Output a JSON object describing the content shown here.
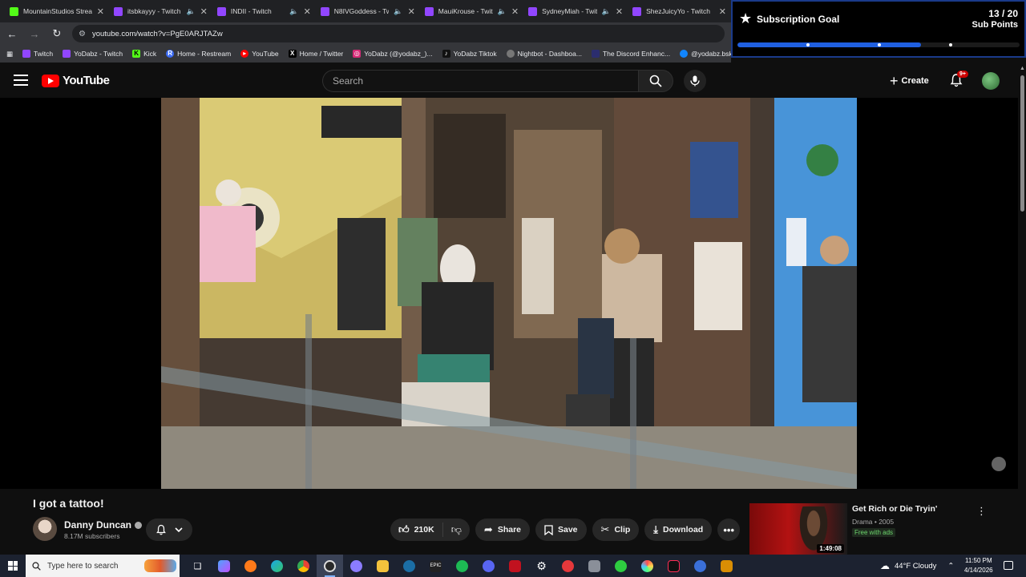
{
  "browser": {
    "tabs": [
      {
        "title": "MountainStudios Strea",
        "favicon": "kick-icon",
        "muted": false
      },
      {
        "title": "itsbkayyy - Twitch",
        "favicon": "twitch-icon",
        "muted": true
      },
      {
        "title": "INDII - Twitch",
        "favicon": "twitch-icon",
        "muted": true
      },
      {
        "title": "N8IVGoddess - Twi",
        "favicon": "twitch-icon",
        "muted": true
      },
      {
        "title": "MauiKrouse - Twit",
        "favicon": "twitch-icon",
        "muted": true
      },
      {
        "title": "SydneyMiah - Twit",
        "favicon": "twitch-icon",
        "muted": true
      },
      {
        "title": "ShezJuicyYo - Twitch",
        "favicon": "twitch-icon",
        "muted": false
      }
    ],
    "url": "youtube.com/watch?v=PgE0ARJTAZw",
    "bookmarks": [
      {
        "label": "Twitch",
        "icon": "twitch-icon",
        "color": "#9146ff"
      },
      {
        "label": "YoDabz - Twitch",
        "icon": "twitch-icon",
        "color": "#9146ff"
      },
      {
        "label": "Kick",
        "icon": "kick-icon",
        "color": "#53fc18"
      },
      {
        "label": "Home - Restream",
        "icon": "restream-icon",
        "color": "#3b6cf6"
      },
      {
        "label": "YouTube",
        "icon": "youtube-icon",
        "color": "#ff0000"
      },
      {
        "label": "Home / Twitter",
        "icon": "x-icon",
        "color": "#000000"
      },
      {
        "label": "YoDabz (@yodabz_)...",
        "icon": "instagram-icon",
        "color": "#d62976"
      },
      {
        "label": "YoDabz Tiktok",
        "icon": "tiktok-icon",
        "color": "#111111"
      },
      {
        "label": "Nightbot - Dashboa...",
        "icon": "nightbot-icon",
        "color": "#777777"
      },
      {
        "label": "The Discord Enhanc...",
        "icon": "discord-icon",
        "color": "#2b2d6e"
      },
      {
        "label": "@yodabz.bsky.socia...",
        "icon": "bluesky-icon",
        "color": "#1185fe"
      }
    ]
  },
  "goal": {
    "title": "Subscription Goal",
    "count": "13 / 20",
    "unit": "Sub Points",
    "progress": 0.65,
    "accent": "#1f5fe0"
  },
  "youtube": {
    "logo_text": "YouTube",
    "search_placeholder": "Search",
    "create_label": "Create",
    "notification_badge": "9+"
  },
  "video": {
    "title": "I got a tattoo!",
    "channel": "Danny Duncan",
    "subscribers": "8.17M subscribers",
    "likes": "210K",
    "actions": {
      "share": "Share",
      "save": "Save",
      "clip": "Clip",
      "download": "Download"
    }
  },
  "recommendation": {
    "title": "Get Rich or Die Tryin'",
    "meta": "Drama • 2005",
    "badge": "Free with ads",
    "duration": "1:49:08"
  },
  "taskbar": {
    "search_placeholder": "Type here to search",
    "weather": "44°F  Cloudy",
    "time": "11:50 PM",
    "date": "4/14/2026"
  }
}
